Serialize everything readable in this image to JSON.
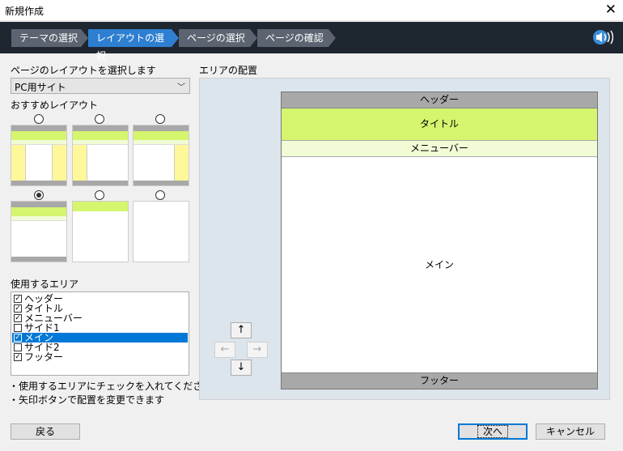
{
  "window": {
    "title": "新規作成",
    "close_glyph": "✕"
  },
  "steps": [
    {
      "label": "テーマの選択",
      "state": "done"
    },
    {
      "label": "レイアウトの選択",
      "state": "active"
    },
    {
      "label": "ページの選択",
      "state": "todo"
    },
    {
      "label": "ページの確認",
      "state": "todo"
    }
  ],
  "layout_select": {
    "label": "ページのレイアウトを選択します",
    "value": "PC用サイト"
  },
  "recommended": {
    "label": "おすすめレイアウト",
    "selected_index": 3
  },
  "areas_label": "使用するエリア",
  "areas": [
    {
      "label": "ヘッダー",
      "checked": true,
      "selected": false
    },
    {
      "label": "タイトル",
      "checked": true,
      "selected": false
    },
    {
      "label": "メニューバー",
      "checked": true,
      "selected": false
    },
    {
      "label": "サイド1",
      "checked": false,
      "selected": false
    },
    {
      "label": "メイン",
      "checked": true,
      "selected": true
    },
    {
      "label": "サイド2",
      "checked": false,
      "selected": false
    },
    {
      "label": "フッター",
      "checked": true,
      "selected": false
    }
  ],
  "notes": [
    "・使用するエリアにチェックを入れてください",
    "・矢印ボタンで配置を変更できます"
  ],
  "placement": {
    "label": "エリアの配置",
    "header": "ヘッダー",
    "title": "タイトル",
    "menubar": "メニューバー",
    "main": "メイン",
    "footer": "フッター"
  },
  "arrows": {
    "up": "↑",
    "left": "←",
    "right": "→",
    "down": "↓"
  },
  "buttons": {
    "back": "戻る",
    "next": "次へ",
    "cancel": "キャンセル"
  },
  "colors": {
    "accent": "#2e7fd1",
    "step_inactive": "#5b6470",
    "title_green": "#d5f56e",
    "menu_green": "#f1fbd6",
    "gray_bar": "#a8a8a8",
    "side_yellow": "#fff89a"
  }
}
